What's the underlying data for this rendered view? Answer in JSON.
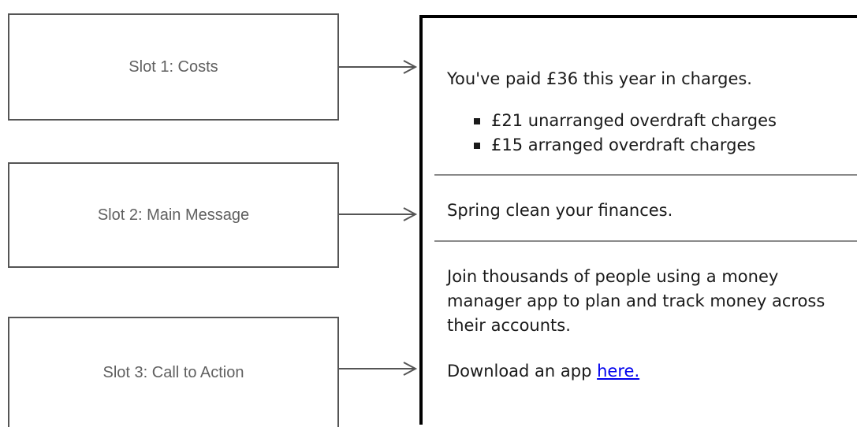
{
  "slots": [
    {
      "label": "Slot 1: Costs"
    },
    {
      "label": "Slot 2: Main Message"
    },
    {
      "label": "Slot 3: Call to Action"
    }
  ],
  "message": {
    "costs_summary": "You've paid £36 this year in charges.",
    "charges": [
      "£21 unarranged overdraft charges",
      "£15 arranged overdraft charges"
    ],
    "main_message": "Spring clean your finances.",
    "body": "Join thousands of people using a money manager app to plan and track money across their accounts.",
    "cta_prefix": "Download an app ",
    "cta_link": "here."
  },
  "colors": {
    "slot_border": "#555555",
    "slot_text": "#606060",
    "arrow": "#555555",
    "panel_border": "#000000",
    "divider": "#8a8a8a",
    "link": "#0000ee"
  }
}
